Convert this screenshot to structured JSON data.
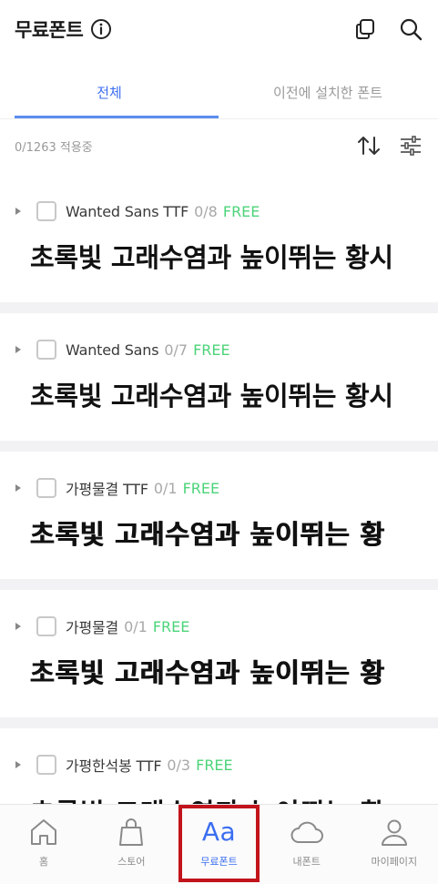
{
  "header": {
    "title": "무료폰트",
    "icons": [
      "info-icon",
      "copy-icon",
      "search-icon"
    ]
  },
  "tabs": [
    {
      "label": "전체",
      "active": true
    },
    {
      "label": "이전에 설치한 폰트",
      "active": false
    }
  ],
  "summary": {
    "count_text": "0/1263 적용중",
    "icons": [
      "sort-icon",
      "filter-icon"
    ]
  },
  "fonts": [
    {
      "name": "Wanted Sans TTF",
      "count": "0/8",
      "badge": "FREE",
      "preview": "초록빛 고래수염과 높이뛰는 황시"
    },
    {
      "name": "Wanted Sans",
      "count": "0/7",
      "badge": "FREE",
      "preview": "초록빛 고래수염과 높이뛰는 황시"
    },
    {
      "name": "가평물결 TTF",
      "count": "0/1",
      "badge": "FREE",
      "preview": "초록빛 고래수염과 높이뛰는 황"
    },
    {
      "name": "가평물결",
      "count": "0/1",
      "badge": "FREE",
      "preview": "초록빛 고래수염과 높이뛰는 황"
    },
    {
      "name": "가평한석봉 TTF",
      "count": "0/3",
      "badge": "FREE",
      "preview": "초록빛 고래수염과 높이뛰는 황"
    }
  ],
  "bottom_nav": [
    {
      "label": "홈",
      "icon": "home-icon",
      "active": false
    },
    {
      "label": "스토어",
      "icon": "shopping-bag-icon",
      "active": false
    },
    {
      "label": "무료폰트",
      "icon": "Aa",
      "active": true
    },
    {
      "label": "내폰트",
      "icon": "cloud-icon",
      "active": false
    },
    {
      "label": "마이페이지",
      "icon": "person-icon",
      "active": false
    }
  ],
  "colors": {
    "accent": "#3b6ef0",
    "free": "#4cd47a",
    "highlight": "#c2141c"
  }
}
